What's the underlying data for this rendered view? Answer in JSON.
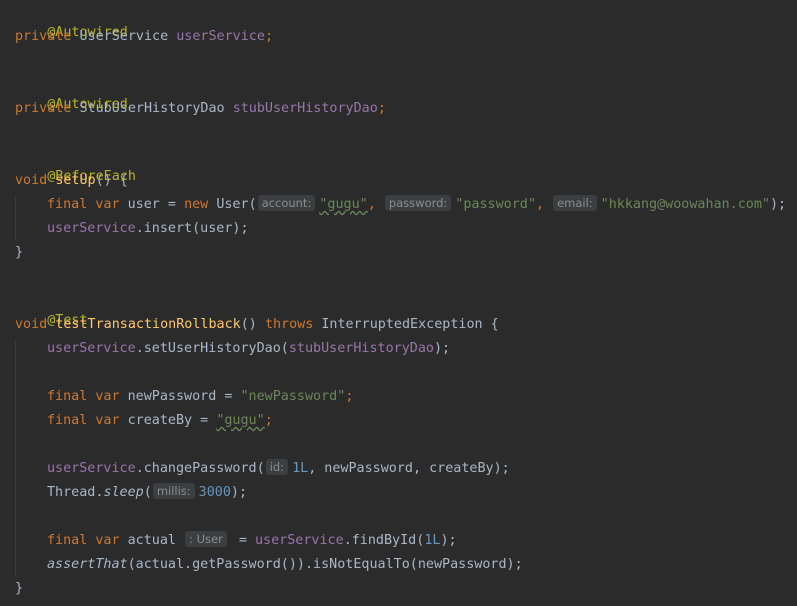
{
  "code": {
    "l1": {
      "ann": "@Autowired"
    },
    "l2": {
      "kw": "private",
      "type": "UserService",
      "field": "userService",
      "semi": ";"
    },
    "l3": {
      "ann": "@Autowired"
    },
    "l4": {
      "kw": "private",
      "type": "StubUserHistoryDao",
      "field": "stubUserHistoryDao",
      "semi": ";"
    },
    "l5": {
      "ann": "@BeforeEach"
    },
    "l6": {
      "kw": "void",
      "method": "setUp",
      "rest": "() {"
    },
    "l7": {
      "kw1": "final",
      "kw2": "var",
      "name": "user",
      "eq": " = ",
      "kw3": "new",
      "ctor": "User(",
      "hint1": "account:",
      "str1": "\"gugu\"",
      "sep1": ", ",
      "hint2": "password:",
      "str2": "\"password\"",
      "sep2": ", ",
      "hint3": "email:",
      "str3": "\"hkkang@woowahan.com\"",
      "end": ");"
    },
    "l8": {
      "field": "userService",
      "rest": ".insert(user);"
    },
    "l9": {
      "brace": "}"
    },
    "l10": {
      "ann": "@Test"
    },
    "l11": {
      "kw": "void",
      "method": "testTransactionRollback",
      "mid": "() ",
      "kw2": "throws",
      "rest": " InterruptedException {"
    },
    "l12": {
      "field1": "userService",
      "mid": ".setUserHistoryDao(",
      "field2": "stubUserHistoryDao",
      "end": ");"
    },
    "l13": {
      "kw1": "final",
      "kw2": "var",
      "rest": "newPassword = ",
      "str": "\"newPassword\"",
      "semi": ";"
    },
    "l14": {
      "kw1": "final",
      "kw2": "var",
      "rest": "createBy = ",
      "str": "\"gugu\"",
      "semi": ";"
    },
    "l15": {
      "field": "userService",
      "mid": ".changePassword(",
      "hint": "id:",
      "num": "1L",
      "rest": ", newPassword, createBy);"
    },
    "l16": {
      "cls": "Thread.",
      "method": "sleep",
      "open": "(",
      "hint": "millis:",
      "num": "3000",
      "end": ");"
    },
    "l17": {
      "kw1": "final",
      "kw2": "var",
      "name": "actual",
      "hint": ": User",
      "eq": " = ",
      "field": "userService",
      "mid": ".findById(",
      "num": "1L",
      "end": ");"
    },
    "l18": {
      "method": "assertThat",
      "rest": "(actual.getPassword()).isNotEqualTo(newPassword);"
    },
    "l19": {
      "brace": "}"
    }
  },
  "colors": {
    "background": "#2b2b2b",
    "annotation": "#bbb529",
    "keyword": "#cc7832",
    "field": "#9876aa",
    "string": "#6a8759",
    "number": "#6897bb",
    "method_decl": "#ffc66d",
    "text": "#a9b7c6"
  }
}
